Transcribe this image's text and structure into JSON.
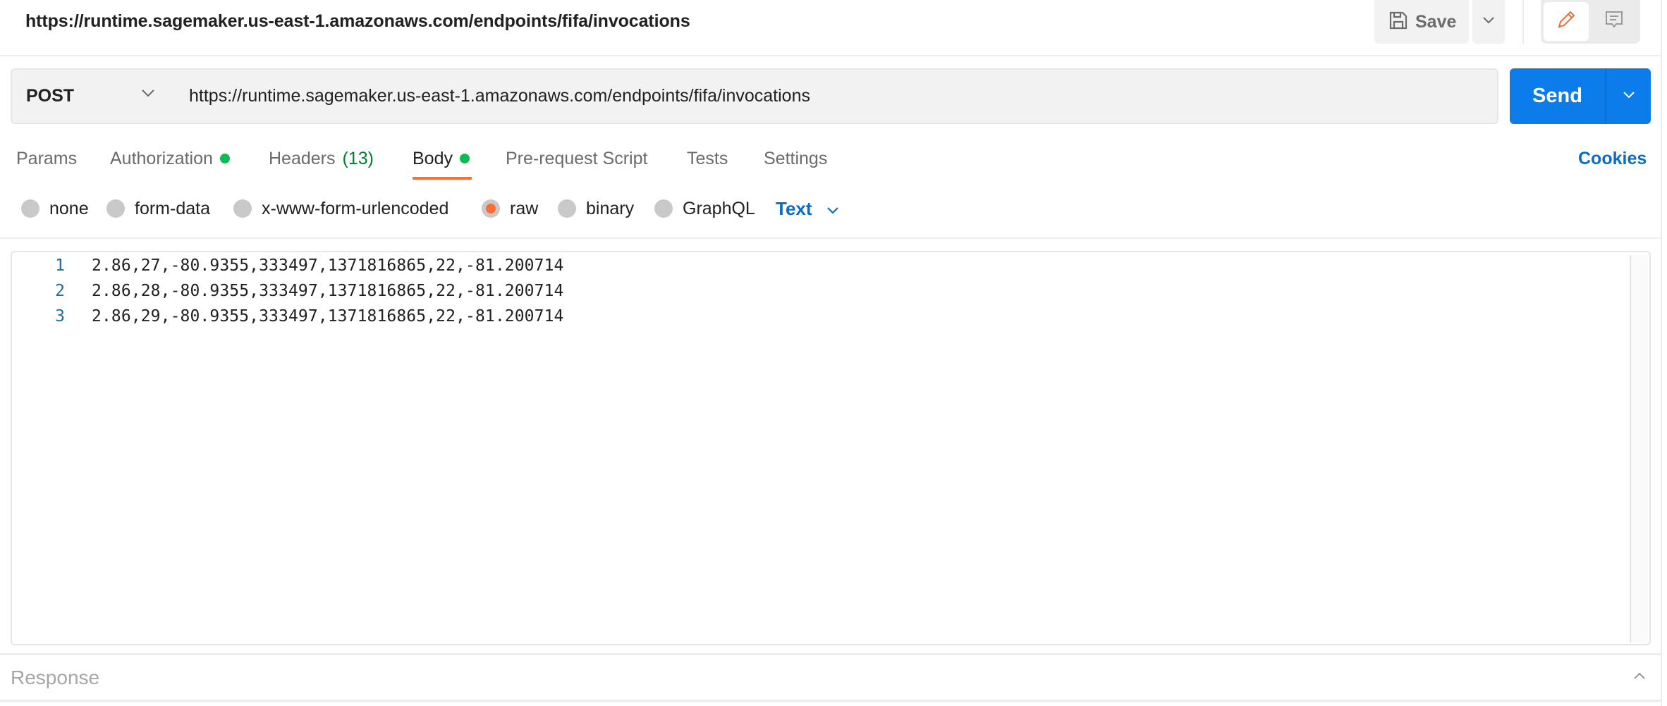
{
  "header": {
    "title": "https://runtime.sagemaker.us-east-1.amazonaws.com/endpoints/fifa/invocations",
    "save_label": "Save",
    "save_icon": "floppy-disk-icon",
    "save_dropdown_icon": "chevron-down-icon",
    "mode_toggle": [
      {
        "name": "edit",
        "icon": "pencil-icon",
        "active": true
      },
      {
        "name": "comments",
        "icon": "comment-icon",
        "active": false
      }
    ]
  },
  "request": {
    "method": "POST",
    "url": "https://runtime.sagemaker.us-east-1.amazonaws.com/endpoints/fifa/invocations",
    "send_label": "Send"
  },
  "tabs": [
    {
      "label": "Params",
      "active": false,
      "dot": false
    },
    {
      "label": "Authorization",
      "active": false,
      "dot": true
    },
    {
      "label": "Headers",
      "count": "(13)",
      "active": false,
      "dot": false
    },
    {
      "label": "Body",
      "active": true,
      "dot": true
    },
    {
      "label": "Pre-request Script",
      "active": false,
      "dot": false
    },
    {
      "label": "Tests",
      "active": false,
      "dot": false
    },
    {
      "label": "Settings",
      "active": false,
      "dot": false
    }
  ],
  "cookies_label": "Cookies",
  "body_types": [
    {
      "label": "none",
      "selected": false
    },
    {
      "label": "form-data",
      "selected": false
    },
    {
      "label": "x-www-form-urlencoded",
      "selected": false
    },
    {
      "label": "raw",
      "selected": true
    },
    {
      "label": "binary",
      "selected": false
    },
    {
      "label": "GraphQL",
      "selected": false
    }
  ],
  "raw_language": "Text",
  "editor": {
    "lines": [
      {
        "number": "1",
        "text": "2.86,27,-80.9355,333497,1371816865,22,-81.200714"
      },
      {
        "number": "2",
        "text": "2.86,28,-80.9355,333497,1371816865,22,-81.200714"
      },
      {
        "number": "3",
        "text": "2.86,29,-80.9355,333497,1371816865,22,-81.200714"
      }
    ]
  },
  "response": {
    "label": "Response",
    "toggle_icon": "chevron-up-icon"
  },
  "colors": {
    "accent": "#ff6c37",
    "send_button": "#0c7ceb",
    "link": "#0b6bcb",
    "status_dot": "#0cbb52"
  }
}
